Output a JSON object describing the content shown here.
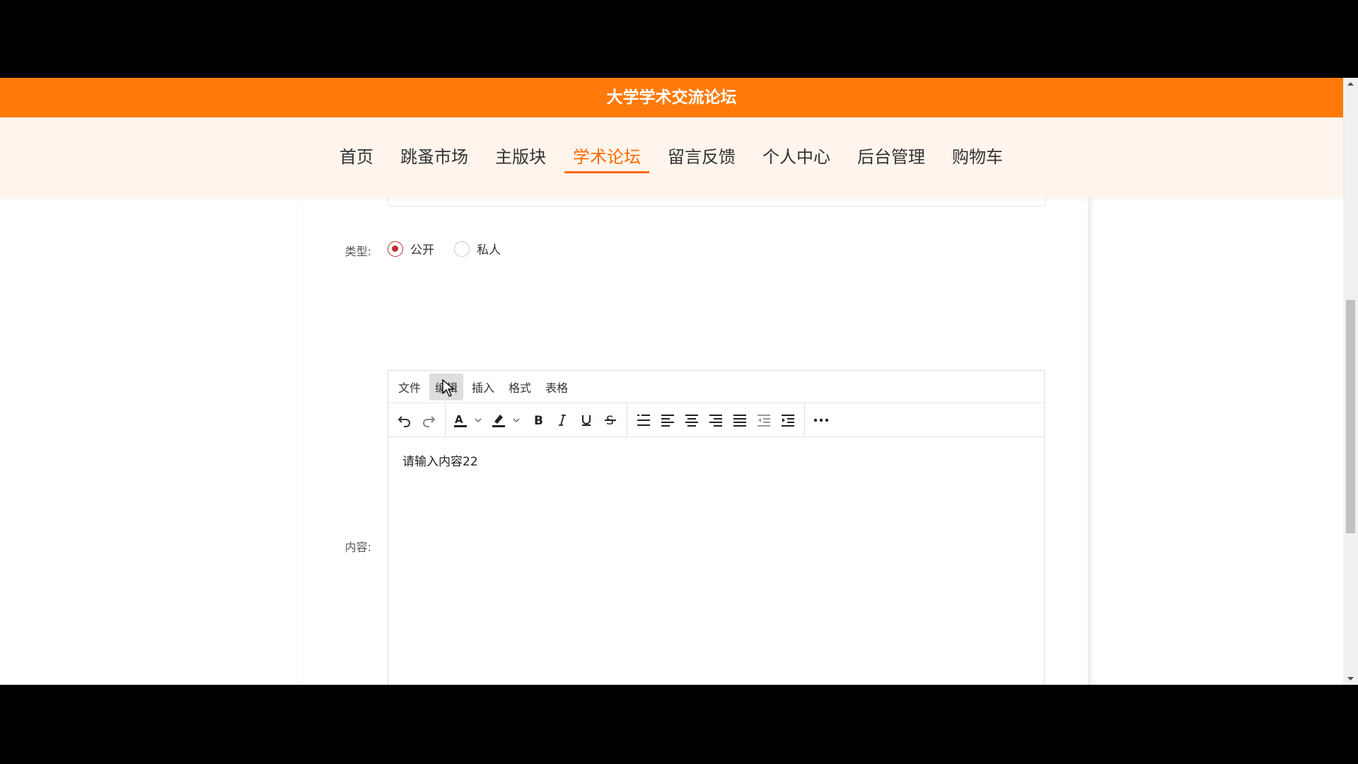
{
  "header": {
    "title": "大学学术交流论坛"
  },
  "nav": {
    "items": [
      {
        "label": "首页",
        "active": false
      },
      {
        "label": "跳蚤市场",
        "active": false
      },
      {
        "label": "主版块",
        "active": false
      },
      {
        "label": "学术论坛",
        "active": true
      },
      {
        "label": "留言反馈",
        "active": false
      },
      {
        "label": "个人中心",
        "active": false
      },
      {
        "label": "后台管理",
        "active": false
      },
      {
        "label": "购物车",
        "active": false
      }
    ]
  },
  "form": {
    "type_label": "类型:",
    "type_options": [
      {
        "label": "公开",
        "checked": true
      },
      {
        "label": "私人",
        "checked": false
      }
    ],
    "content_label": "内容:"
  },
  "editor": {
    "menus": [
      "文件",
      "编辑",
      "插入",
      "格式",
      "表格"
    ],
    "hovered_menu": "编辑",
    "content_text": "请输入内容22",
    "toolbar_icons": [
      "undo-icon",
      "redo-icon",
      "text-color-icon",
      "highlight-color-icon",
      "bold-icon",
      "italic-icon",
      "underline-icon",
      "strikethrough-icon",
      "line-height-icon",
      "align-left-icon",
      "align-center-icon",
      "align-right-icon",
      "align-justify-icon",
      "outdent-icon",
      "indent-icon",
      "more-icon"
    ]
  },
  "colors": {
    "header_bg": "#ff7a0a",
    "nav_bg": "#fff5ec",
    "accent": "#ff6a00",
    "radio_checked": "#c03030"
  }
}
